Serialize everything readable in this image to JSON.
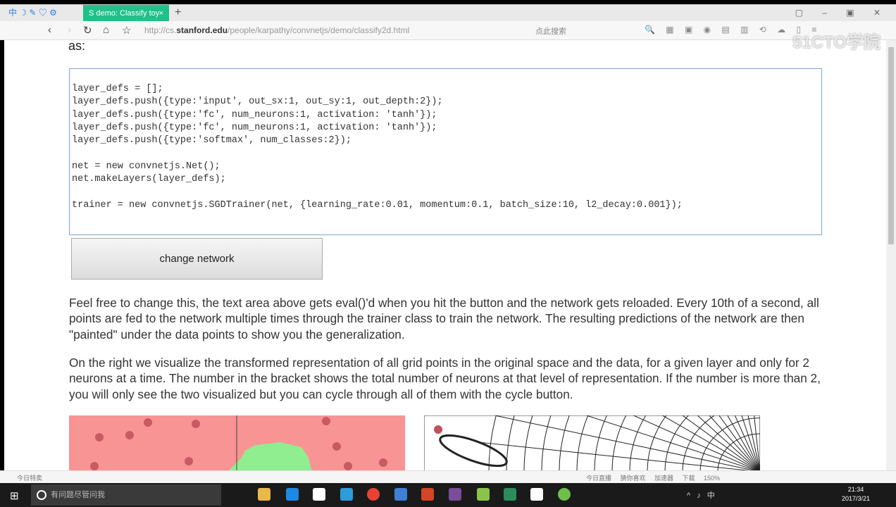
{
  "browser": {
    "tab_title": "S demo: Classify toy",
    "tab_close": "×",
    "new_tab": "+",
    "toolbar_icons": "中 ☽ ✎ ♡ ⚙",
    "window_controls": "▢ – ▣ ✕",
    "url_prefix": "http://cs.",
    "url_domain": "stanford.edu",
    "url_path": "/people/karpathy/convnetjs/demo/classify2d.html",
    "search_placeholder": "点此搜索",
    "watermark": "51CTO学院"
  },
  "page": {
    "intro_tail": "as:",
    "code": "layer_defs = [];\nlayer_defs.push({type:'input', out_sx:1, out_sy:1, out_depth:2});\nlayer_defs.push({type:'fc', num_neurons:1, activation: 'tanh'});\nlayer_defs.push({type:'fc', num_neurons:1, activation: 'tanh'});\nlayer_defs.push({type:'softmax', num_classes:2});\n\nnet = new convnetjs.Net();\nnet.makeLayers(layer_defs);\n\ntrainer = new convnetjs.SGDTrainer(net, {learning_rate:0.01, momentum:0.1, batch_size:10, l2_decay:0.001});",
    "change_network_label": "change network",
    "paragraph1": "Feel free to change this, the text area above gets eval()'d when you hit the button and the network gets reloaded. Every 10th of a second, all points are fed to the network multiple times through the trainer class to train the network. The resulting predictions of the network are then \"painted\" under the data points to show you the generalization.",
    "paragraph2": "On the right we visualize the transformed representation of all grid points in the original space and the data, for a given layer and only for 2 neurons at a time. The number in the bracket shows the total number of neurons at that level of representation. If the number is more than 2, you will only see the two visualized but you can cycle through all of them with the cycle button.",
    "colors": {
      "region_red": "#f99494",
      "region_green": "#90ee90",
      "point_red": "#c0505a"
    }
  },
  "statusbar": {
    "left": "今日特卖",
    "right": "今日直播 猜你喜欢 加速器 下载 150%"
  },
  "taskbar": {
    "search_placeholder": "有问题尽管问我",
    "tray": "^ ♪ 中",
    "time": "21:34",
    "date": "2017/3/21"
  }
}
